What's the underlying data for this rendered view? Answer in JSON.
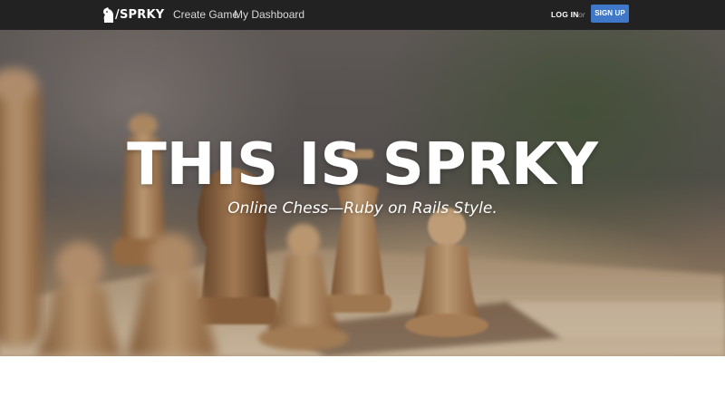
{
  "navbar": {
    "brand": "/SPRKY",
    "links": {
      "create_game": "Create Game",
      "my_dashboard": "My Dashboard"
    },
    "login": "LOG IN",
    "or": "or",
    "signup": "SIGN UP"
  },
  "hero": {
    "title": "THIS IS SPRKY",
    "subtitle": "Online Chess—Ruby on Rails Style."
  },
  "colors": {
    "navbar_bg": "#222222",
    "signup_bg": "#3f78c9",
    "hero_text": "#ffffff"
  },
  "icons": {
    "brand_logo": "knight-icon"
  }
}
